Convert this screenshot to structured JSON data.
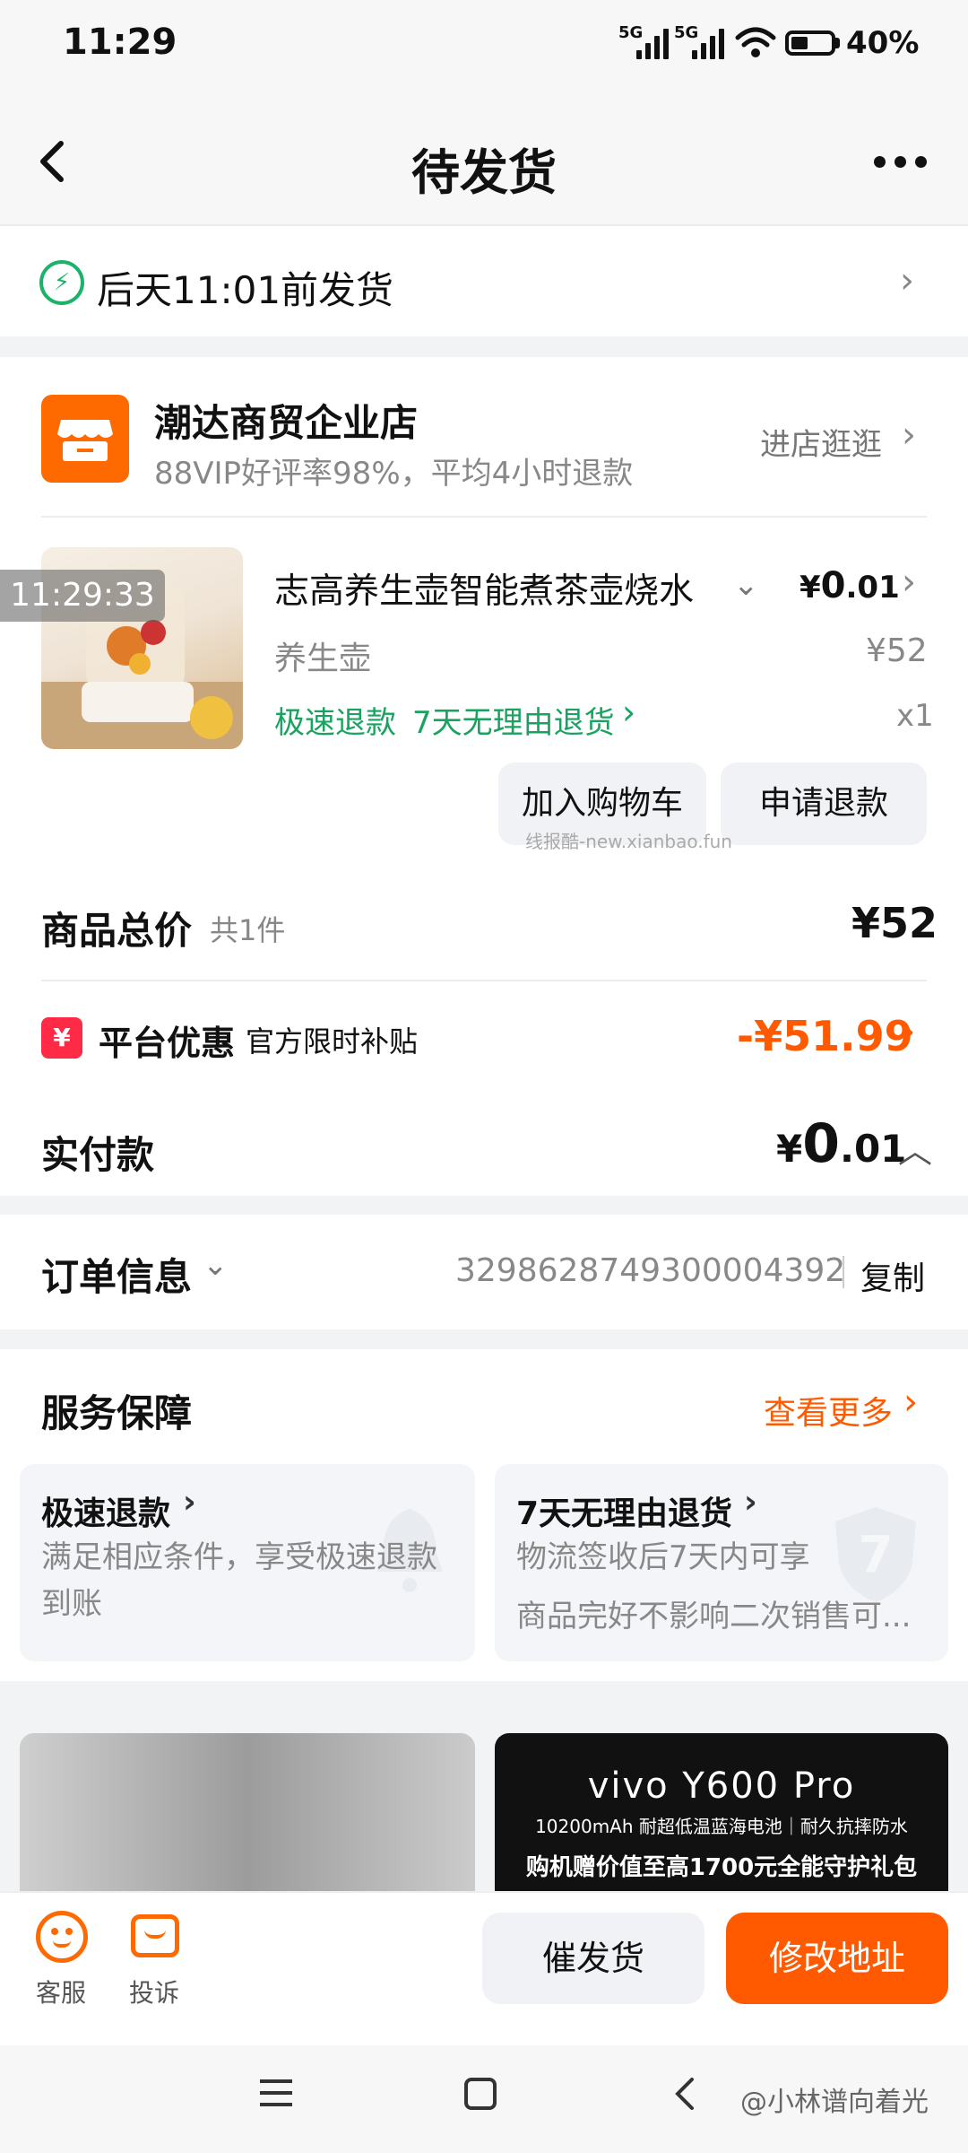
{
  "status_bar": {
    "time": "11:29",
    "signal1": "5G",
    "signal2": "5G",
    "battery": "40%"
  },
  "nav": {
    "title": "待发货"
  },
  "delivery": {
    "text": "后天11:01前发货"
  },
  "shop": {
    "name": "潮达商贸企业店",
    "subtitle": "88VIP好评率98%，平均4小时退款",
    "link": "进店逛逛"
  },
  "product": {
    "timestamp": "11:29:33",
    "title": "志高养生壶智能煮茶壶烧水",
    "price_symbol": "¥",
    "price_int": "0",
    "price_dec": ".01",
    "spec": "养生壶",
    "original_price": "¥52",
    "tag_refund": "极速退款",
    "tag_return": "7天无理由退货",
    "qty": "x1",
    "btn_cart": "加入购物车",
    "btn_refund": "申请退款",
    "watermark": "线报酷-new.xianbao.fun"
  },
  "summary": {
    "total_label": "商品总价",
    "total_count": "共1件",
    "total_value": "¥52",
    "discount_label": "平台优惠",
    "discount_sub": "官方限时补贴",
    "discount_value": "-¥51.99",
    "paid_label": "实付款",
    "paid_symbol": "¥",
    "paid_int": "0",
    "paid_dec": ".01"
  },
  "order": {
    "label": "订单信息",
    "number": "3298628749300004392",
    "copy": "复制"
  },
  "service": {
    "title": "服务保障",
    "more": "查看更多",
    "items": [
      {
        "title": "极速退款",
        "line1": "满足相应条件，享受极速退款",
        "line2": "到账"
      },
      {
        "title": "7天无理由退货",
        "line1": "物流签收后7天内可享",
        "line2": "商品完好不影响二次销售可..."
      }
    ]
  },
  "ad": {
    "brand": "vivo Y600 Pro",
    "line1": "10200mAh 耐超低温蓝海电池｜耐久抗摔防水",
    "line2": "购机赠价值至高1700元全能守护礼包"
  },
  "bottom": {
    "service_label": "客服",
    "complain_label": "投诉",
    "urge_label": "催发货",
    "address_label": "修改地址"
  },
  "watermark_weibo": "@小林谱向着光",
  "colors": {
    "accent": "#ff5a00",
    "green": "#1aa260",
    "shop": "#ff6a00"
  }
}
